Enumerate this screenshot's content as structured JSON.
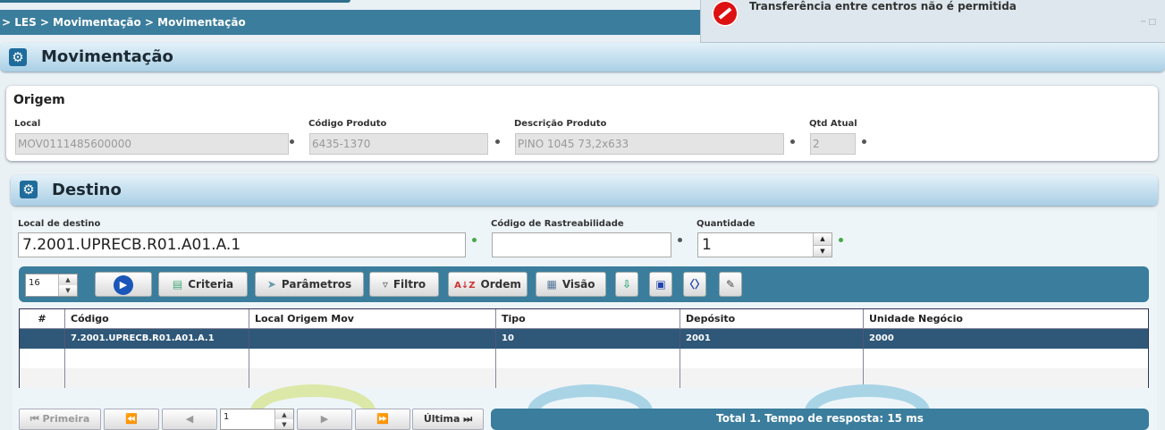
{
  "breadcrumb": "> LES > Movimentação > Movimentação",
  "notification": {
    "message": "Transferência entre centros não é permitida"
  },
  "panel1": {
    "title": "Movimentação"
  },
  "origem": {
    "title": "Origem",
    "local_label": "Local",
    "local_value": "MOV0111485600000",
    "codigo_label": "Código Produto",
    "codigo_value": "6435-1370",
    "descricao_label": "Descrição Produto",
    "descricao_value": "PINO 1045 73,2x633",
    "qtd_label": "Qtd Atual",
    "qtd_value": "2"
  },
  "destino": {
    "title": "Destino",
    "local_label": "Local de destino",
    "local_value": "7.2001.UPRECB.R01.A01.A.1",
    "rastreabilidade_label": "Código de Rastreabilidade",
    "rastreabilidade_value": "",
    "quantidade_label": "Quantidade",
    "quantidade_value": "1"
  },
  "toolbar": {
    "page_size": "16",
    "criteria": "Criteria",
    "parametros": "Parâmetros",
    "filtro": "Filtro",
    "ordem": "Ordem",
    "visao": "Visão"
  },
  "grid": {
    "columns": [
      "#",
      "Código",
      "Local Origem Mov",
      "Tipo",
      "Depósito",
      "Unidade Negócio"
    ],
    "rows": [
      [
        "",
        "7.2001.UPRECB.R01.A01.A.1",
        "",
        "10",
        "2001",
        "2000"
      ]
    ]
  },
  "pager": {
    "first": "Primeira",
    "last": "Última",
    "page": "1",
    "status": "Total 1. Tempo de resposta: 15 ms"
  }
}
